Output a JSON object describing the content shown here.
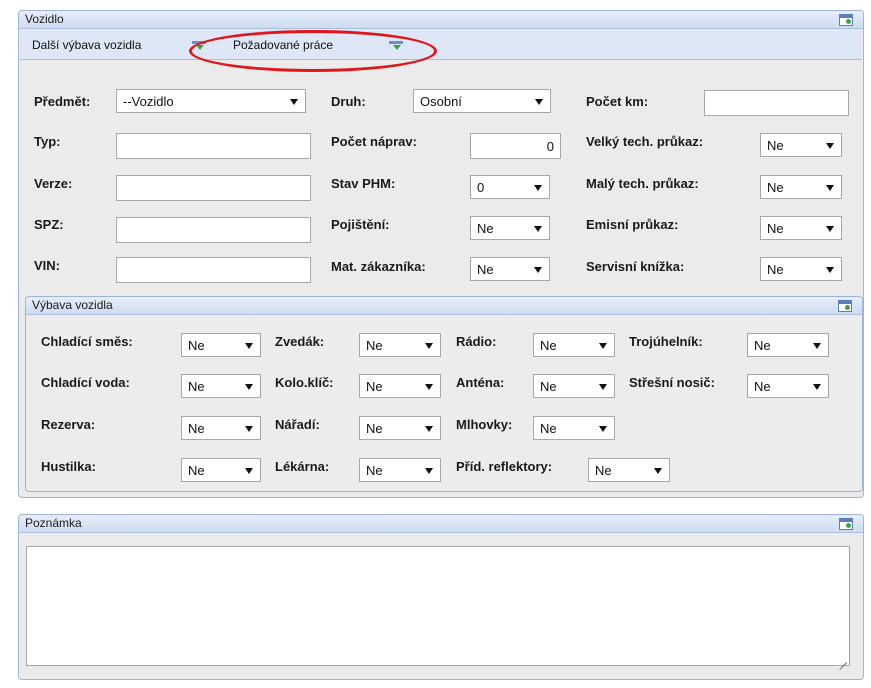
{
  "vozidlo_panel": {
    "title": "Vozidlo",
    "tabs": [
      {
        "label": "Další výbava vozidla"
      },
      {
        "label": "Požadované práce"
      }
    ],
    "fields": {
      "predmet": {
        "label": "Předmět:",
        "value": "--Vozidlo"
      },
      "druh": {
        "label": "Druh:",
        "value": "Osobní"
      },
      "pocet_km": {
        "label": "Počet km:",
        "value": ""
      },
      "typ": {
        "label": "Typ:",
        "value": ""
      },
      "pocet_naprav": {
        "label": "Počet náprav:",
        "value": "0"
      },
      "velky_tp": {
        "label": "Velký tech. průkaz:",
        "value": "Ne"
      },
      "verze": {
        "label": "Verze:",
        "value": ""
      },
      "stav_phm": {
        "label": "Stav PHM:",
        "value": "0"
      },
      "maly_tp": {
        "label": "Malý tech. průkaz:",
        "value": "Ne"
      },
      "spz": {
        "label": "SPZ:",
        "value": ""
      },
      "pojisteni": {
        "label": "Pojištění:",
        "value": "Ne"
      },
      "emisni": {
        "label": "Emisní průkaz:",
        "value": "Ne"
      },
      "vin": {
        "label": "VIN:",
        "value": ""
      },
      "mat_zakaznika": {
        "label": "Mat. zákazníka:",
        "value": "Ne"
      },
      "servisni": {
        "label": "Servisní knížka:",
        "value": "Ne"
      }
    }
  },
  "vybava_panel": {
    "title": "Výbava vozidla",
    "items": [
      {
        "label": "Chladící směs:",
        "value": "Ne"
      },
      {
        "label": "Zvedák:",
        "value": "Ne"
      },
      {
        "label": "Rádio:",
        "value": "Ne"
      },
      {
        "label": "Trojúhelník:",
        "value": "Ne"
      },
      {
        "label": "Chladící voda:",
        "value": "Ne"
      },
      {
        "label": "Kolo.klíč:",
        "value": "Ne"
      },
      {
        "label": "Anténa:",
        "value": "Ne"
      },
      {
        "label": "Střešní nosič:",
        "value": "Ne"
      },
      {
        "label": "Rezerva:",
        "value": "Ne"
      },
      {
        "label": "Nářadí:",
        "value": "Ne"
      },
      {
        "label": "Mlhovky:",
        "value": "Ne"
      },
      {
        "label": "Hustilka:",
        "value": "Ne"
      },
      {
        "label": "Lékárna:",
        "value": "Ne"
      },
      {
        "label": "Příd. reflektory:",
        "value": "Ne"
      }
    ]
  },
  "poznamka_panel": {
    "title": "Poznámka",
    "text": ""
  },
  "colors": {
    "highlight_circle": "#e0161b",
    "panel_border": "#9fb4d6",
    "panel_bg": "#ebebeb"
  }
}
